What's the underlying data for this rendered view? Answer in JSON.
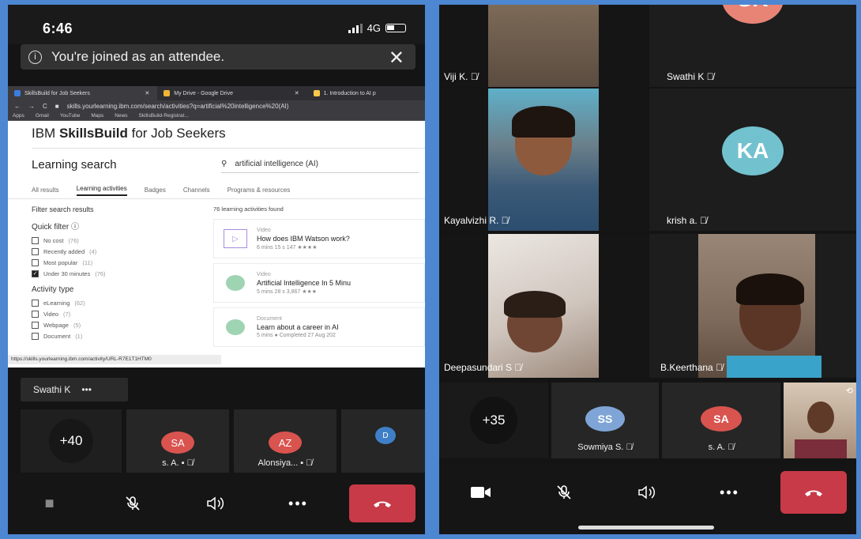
{
  "left_phone": {
    "time": "6:46",
    "network": "4G",
    "banner_text": "You're joined as an attendee.",
    "browser": {
      "tabs": [
        {
          "label": "SkillsBuild for Job Seekers",
          "color": "#3b7de0"
        },
        {
          "label": "My Drive - Google Drive",
          "color": "#f1b434"
        },
        {
          "label": "1. Introduction to AI p",
          "color": "#f7c948"
        }
      ],
      "url": "skills.yourlearning.ibm.com/search/activities?q=artificial%20intelligence%20(AI)",
      "bookmarks": [
        "Apps",
        "Gmail",
        "YouTube",
        "Maps",
        "News",
        "SkillsBuild-Registrat..."
      ],
      "site_title_prefix": "IBM ",
      "site_title_bold": "SkillsBuild",
      "site_title_suffix": " for Job Seekers",
      "page_heading": "Learning search",
      "search_value": "artificial intelligence (AI)",
      "nav_tabs": [
        "All results",
        "Learning activities",
        "Badges",
        "Channels",
        "Programs & resources"
      ],
      "filter_title": "Filter search results",
      "quick_filter_label": "Quick filter",
      "quick_filters": [
        {
          "label": "No cost",
          "count": "(76)",
          "checked": false
        },
        {
          "label": "Recently added",
          "count": "(4)",
          "checked": false
        },
        {
          "label": "Most popular",
          "count": "(11)",
          "checked": false
        },
        {
          "label": "Under 30 minutes",
          "count": "(76)",
          "checked": true
        }
      ],
      "activity_type_label": "Activity type",
      "activity_types": [
        {
          "label": "eLearning",
          "count": "(62)"
        },
        {
          "label": "Video",
          "count": "(7)"
        },
        {
          "label": "Webpage",
          "count": "(5)"
        },
        {
          "label": "Document",
          "count": "(1)"
        }
      ],
      "results_count": "76 learning activities found",
      "results": [
        {
          "kind": "Video",
          "title": "How does IBM Watson work?",
          "meta": "6 mins 15 s   147   ★★★★"
        },
        {
          "kind": "Video",
          "title": "Artificial Intelligence In 5 Minu",
          "meta": "5 mins 28 s   3,867   ★★★"
        },
        {
          "kind": "Document",
          "title": "Learn about a career in AI",
          "meta": "5 mins   ● Completed 27 Aug 202"
        }
      ],
      "status_url": "https://skills.yourlearning.ibm.com/activity/URL-R7E1T1HTM0"
    },
    "speaker": "Swathi K",
    "speaker_more": "•••",
    "participant_count": "+40",
    "participants": [
      {
        "initials": "SA",
        "name": "s. A.",
        "color": "#d9534f"
      },
      {
        "initials": "AZ",
        "name": "Alonsiya...",
        "color": "#d9534f"
      },
      {
        "initials": "D",
        "name": "",
        "color": "#3f7fc7"
      }
    ]
  },
  "right_phone": {
    "tiles": [
      {
        "name": "Viji K."
      },
      {
        "name": "Swathi K",
        "initials": "SK",
        "color": "#e88476"
      },
      {
        "name": "Kayalvizhi R."
      },
      {
        "name": "krish a.",
        "initials": "KA",
        "color": "#72c1cf"
      },
      {
        "name": "Deepasundari S"
      },
      {
        "name": "B.Keerthana"
      }
    ],
    "participant_count": "+35",
    "participants": [
      {
        "initials": "SS",
        "name": "Sowmiya S.",
        "color": "#7fa5d6"
      },
      {
        "initials": "SA",
        "name": "s. A.",
        "color": "#d9534f"
      }
    ]
  }
}
